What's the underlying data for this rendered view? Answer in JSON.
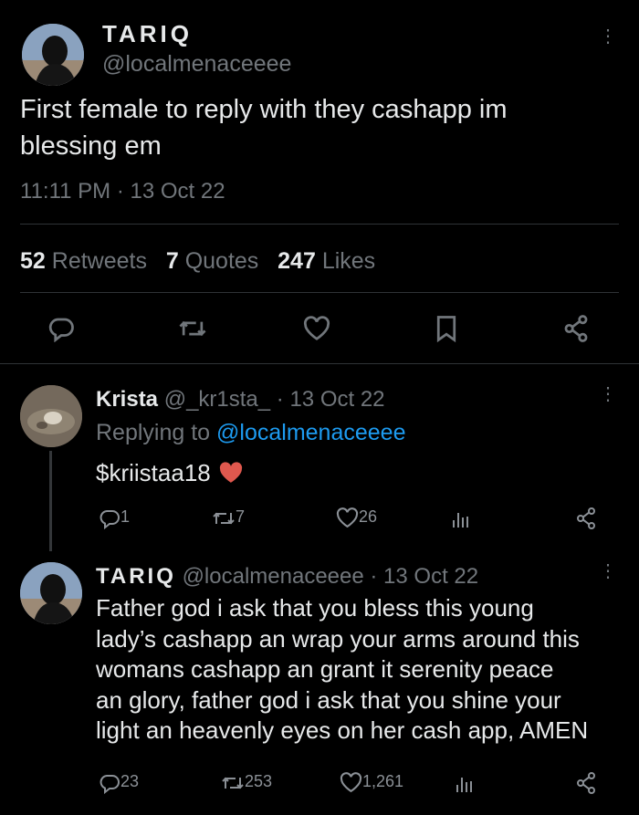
{
  "main_tweet": {
    "display_name": "TARIQ",
    "handle": "@localmenaceeee",
    "text_line1": "First female to reply with they cashapp im",
    "text_line2": "blessing em",
    "timestamp": "11:11 PM · 13 Oct 22",
    "stats": {
      "retweets_count": "52",
      "retweets_label": "Retweets",
      "quotes_count": "7",
      "quotes_label": "Quotes",
      "likes_count": "247",
      "likes_label": "Likes"
    }
  },
  "reply1": {
    "display_name": "Krista",
    "handle": "@_kr1sta_",
    "date": "· 13 Oct 22",
    "replying_label": "Replying to",
    "replying_handle": "@localmenaceeee",
    "text": "$kriistaa18",
    "reply_count": "1",
    "retweet_count": "7",
    "like_count": "26"
  },
  "reply2": {
    "display_name": "TARIQ",
    "handle": "@localmenaceeee",
    "date": "· 13 Oct 22",
    "lines": [
      "Father god i ask that you bless this young",
      "lady’s cashapp an wrap your arms around this",
      "womans cashapp an grant it serenity peace",
      "an glory, father god i ask that you shine your",
      "light an heavenly eyes on her cash app, AMEN"
    ],
    "reply_count": "23",
    "retweet_count": "253",
    "like_count": "1,261"
  },
  "colors": {
    "background": "#000000",
    "text": "#e7e9ea",
    "muted": "#71767b",
    "accent": "#1d9bf0",
    "heart_emoji": "#e0584e"
  },
  "icons": [
    "reply-icon",
    "retweet-icon",
    "like-icon",
    "bookmark-icon",
    "share-icon",
    "analytics-icon",
    "more-icon",
    "heart-emoji-icon"
  ]
}
